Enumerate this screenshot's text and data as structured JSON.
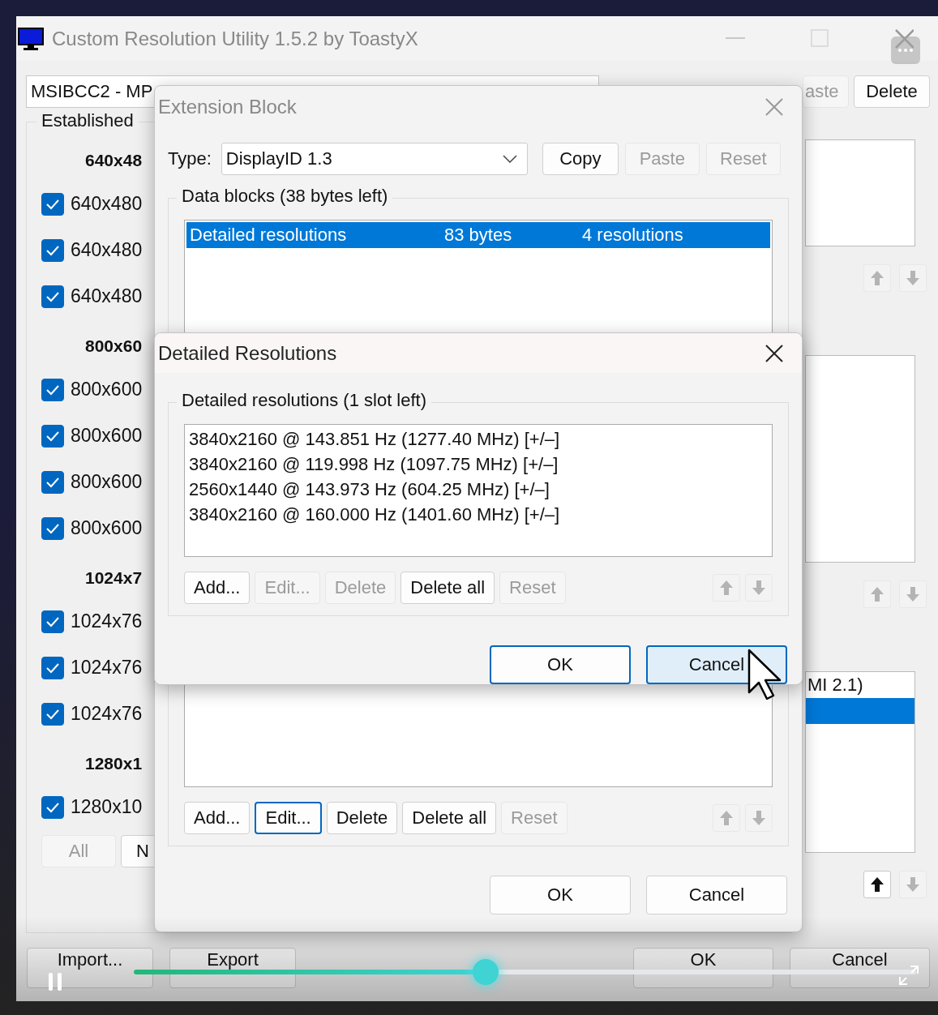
{
  "main_window": {
    "title": "Custom Resolution Utility 1.5.2 by ToastyX",
    "device": "MSIBCC2 - MP",
    "toolbar_buttons": [
      {
        "label": "aste",
        "disabled": true
      },
      {
        "label": "Delete",
        "disabled": false
      }
    ],
    "established": {
      "label": "Established",
      "groups": [
        {
          "heading": "640x48",
          "items": [
            {
              "label": "640x480",
              "checked": true
            },
            {
              "label": "640x480",
              "checked": true
            },
            {
              "label": "640x480",
              "checked": true
            }
          ]
        },
        {
          "heading": "800x60",
          "items": [
            {
              "label": "800x600",
              "checked": true
            },
            {
              "label": "800x600",
              "checked": true
            },
            {
              "label": "800x600",
              "checked": true
            },
            {
              "label": "800x600",
              "checked": true
            }
          ]
        },
        {
          "heading": "1024x7",
          "items": [
            {
              "label": "1024x76",
              "checked": true
            },
            {
              "label": "1024x76",
              "checked": true
            },
            {
              "label": "1024x76",
              "checked": true
            }
          ]
        },
        {
          "heading": "1280x1",
          "items": [
            {
              "label": "1280x10",
              "checked": true
            }
          ]
        }
      ],
      "buttons": [
        {
          "label": "All",
          "disabled": true
        },
        {
          "label": "N",
          "disabled": false
        }
      ]
    },
    "side_lists": [
      {
        "up_disabled": true,
        "down_disabled": true
      },
      {
        "up_disabled": true,
        "down_disabled": true
      },
      {
        "rows": [
          {
            "text": "MI 2.1)",
            "selected": false
          },
          {
            "selected": true
          }
        ],
        "up_disabled": false,
        "down_disabled": true
      }
    ],
    "bottom_left_buttons": [
      {
        "label": "Import..."
      },
      {
        "label": "Export"
      }
    ],
    "bottom_right_buttons": [
      {
        "label": "OK"
      },
      {
        "label": "Cancel"
      }
    ]
  },
  "extension_dialog": {
    "title": "Extension Block",
    "type_label": "Type:",
    "type_value": "DisplayID 1.3",
    "type_buttons": [
      {
        "label": "Copy",
        "disabled": false
      },
      {
        "label": "Paste",
        "disabled": true
      },
      {
        "label": "Reset",
        "disabled": true
      }
    ],
    "group_label": "Data blocks (38 bytes left)",
    "blocks": [
      {
        "name": "Detailed resolutions",
        "size": "83 bytes",
        "info": "4 resolutions",
        "selected": true
      }
    ],
    "list_buttons": [
      {
        "label": "Add...",
        "disabled": false,
        "focused": false
      },
      {
        "label": "Edit...",
        "disabled": false,
        "focused": true
      },
      {
        "label": "Delete",
        "disabled": false,
        "focused": false
      },
      {
        "label": "Delete all",
        "disabled": false,
        "focused": false
      },
      {
        "label": "Reset",
        "disabled": true,
        "focused": false
      }
    ],
    "up_disabled": true,
    "down_disabled": true,
    "dialog_buttons": [
      {
        "label": "OK",
        "default": false,
        "hovered": false
      },
      {
        "label": "Cancel",
        "default": false,
        "hovered": false
      }
    ]
  },
  "resolutions_dialog": {
    "title": "Detailed Resolutions",
    "group_label": "Detailed resolutions (1 slot left)",
    "resolutions": [
      "3840x2160 @ 143.851 Hz (1277.40 MHz) [+/–]",
      "3840x2160 @ 119.998 Hz (1097.75 MHz) [+/–]",
      "2560x1440 @ 143.973 Hz (604.25 MHz) [+/–]",
      "3840x2160 @ 160.000 Hz (1401.60 MHz) [+/–]"
    ],
    "list_buttons": [
      {
        "label": "Add...",
        "disabled": false,
        "focused": false
      },
      {
        "label": "Edit...",
        "disabled": true,
        "focused": false
      },
      {
        "label": "Delete",
        "disabled": true,
        "focused": false
      },
      {
        "label": "Delete all",
        "disabled": false,
        "focused": false
      },
      {
        "label": "Reset",
        "disabled": true,
        "focused": false
      }
    ],
    "up_disabled": true,
    "down_disabled": true,
    "dialog_buttons": [
      {
        "label": "OK",
        "default": true,
        "hovered": false
      },
      {
        "label": "Cancel",
        "default": false,
        "hovered": true
      }
    ]
  },
  "video_player": {
    "level": 0.45
  }
}
